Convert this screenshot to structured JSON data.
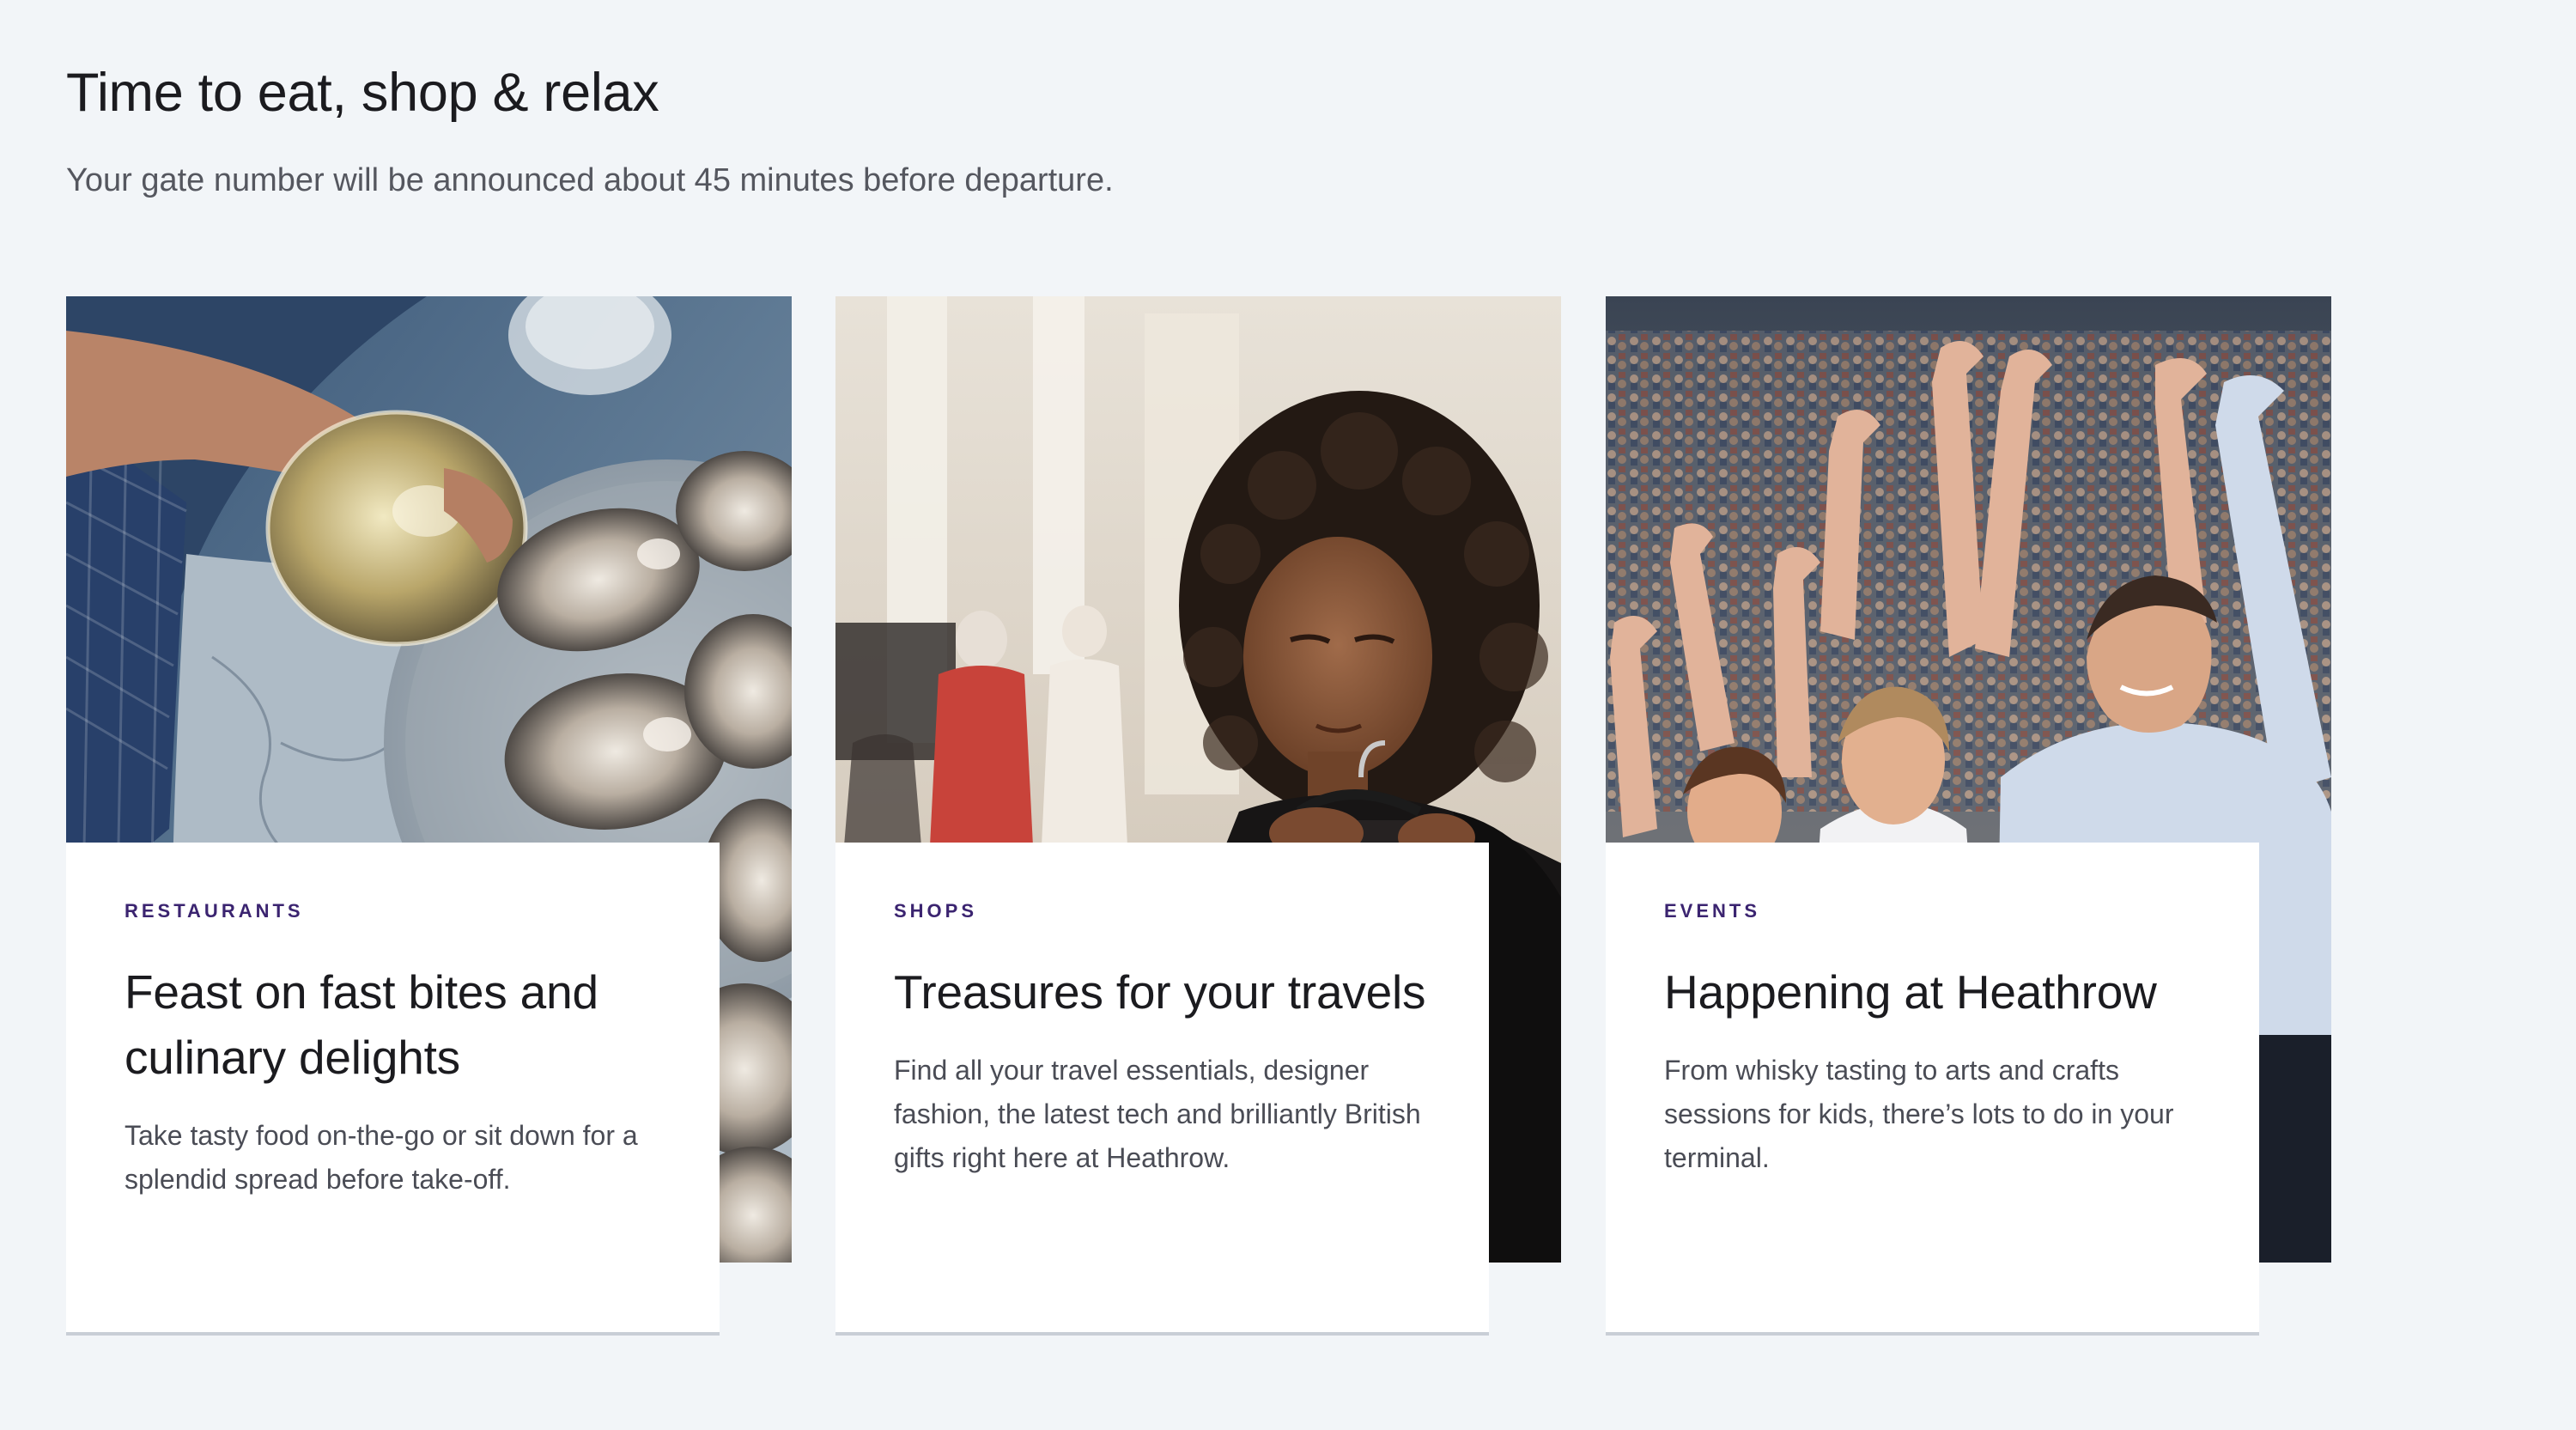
{
  "section": {
    "title": "Time to eat, shop & relax",
    "subtitle": "Your gate number will be announced about 45 minutes before departure."
  },
  "cards": [
    {
      "tag": "RESTAURANTS",
      "heading": "Feast on fast bites and culinary delights",
      "description": "Take tasty food on-the-go or sit down for a splendid spread before take-off."
    },
    {
      "tag": "SHOPS",
      "heading": "Treasures for your travels",
      "description": "Find all your travel essentials, designer fashion, the latest tech and brilliantly British gifts right here at Heathrow."
    },
    {
      "tag": "EVENTS",
      "heading": "Happening at Heathrow",
      "description": "From whisky tasting to arts and crafts sessions for kids, there’s lots to do in your terminal."
    }
  ],
  "colors": {
    "page_background": "#f2f5f8",
    "tag_purple": "#3b2470",
    "panel_background": "#ffffff",
    "panel_border": "#c9ced6"
  }
}
